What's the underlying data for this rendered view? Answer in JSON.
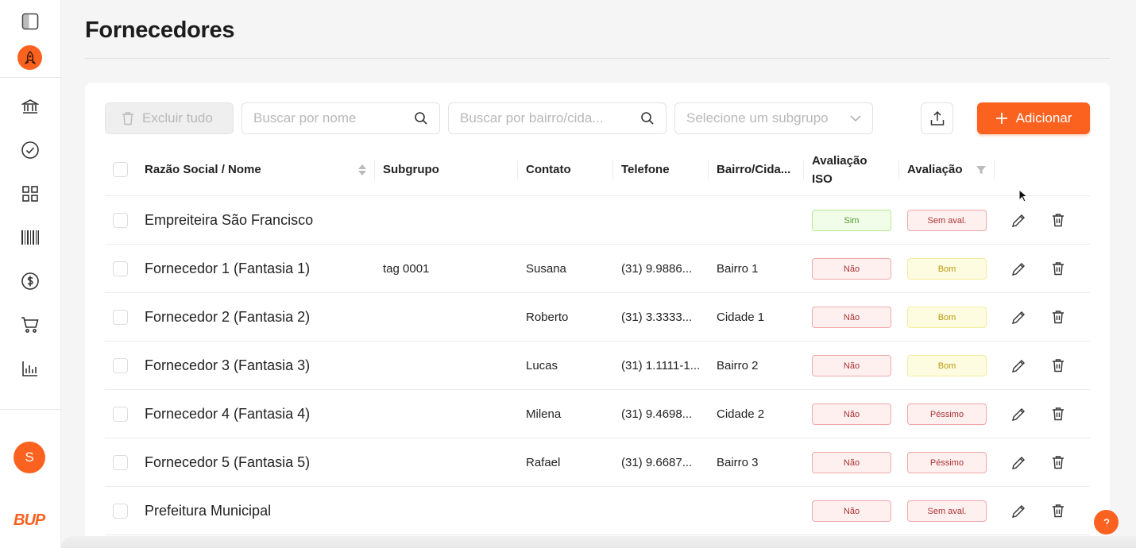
{
  "colors": {
    "accent": "#fb6220"
  },
  "sidebar": {
    "user_initial": "S",
    "brand": "BUP",
    "items": [
      {
        "icon": "bank-icon"
      },
      {
        "icon": "check-circle-icon"
      },
      {
        "icon": "grid-icon"
      },
      {
        "icon": "barcode-icon"
      },
      {
        "icon": "dollar-icon"
      },
      {
        "icon": "cart-icon"
      },
      {
        "icon": "bar-chart-icon"
      }
    ]
  },
  "header": {
    "title": "Fornecedores"
  },
  "toolbar": {
    "delete_all_label": "Excluir tudo",
    "search_name_placeholder": "Buscar por nome",
    "search_location_placeholder": "Buscar por bairro/cida...",
    "subgroup_placeholder": "Selecione um subgrupo",
    "add_label": "Adicionar"
  },
  "table": {
    "columns": {
      "name": "Razão Social / Nome",
      "subgroup": "Subgrupo",
      "contact": "Contato",
      "phone": "Telefone",
      "location": "Bairro/Cida...",
      "iso_line1": "Avaliação",
      "iso_line2": "ISO",
      "rating": "Avaliação"
    },
    "rows": [
      {
        "name": "Empreiteira São Francisco",
        "subgroup": "",
        "contact": "",
        "phone": "",
        "location": "",
        "iso": "Sim",
        "rating": "Sem aval."
      },
      {
        "name": "Fornecedor 1 (Fantasia 1)",
        "subgroup": "tag 0001",
        "contact": "Susana",
        "phone": "(31) 9.9886...",
        "location": "Bairro 1",
        "iso": "Não",
        "rating": "Bom"
      },
      {
        "name": "Fornecedor 2 (Fantasia 2)",
        "subgroup": "",
        "contact": "Roberto",
        "phone": "(31) 3.3333...",
        "location": "Cidade 1",
        "iso": "Não",
        "rating": "Bom"
      },
      {
        "name": "Fornecedor 3 (Fantasia 3)",
        "subgroup": "",
        "contact": "Lucas",
        "phone": "(31) 1.1111-1...",
        "location": "Bairro 2",
        "iso": "Não",
        "rating": "Bom"
      },
      {
        "name": "Fornecedor 4 (Fantasia 4)",
        "subgroup": "",
        "contact": "Milena",
        "phone": "(31) 9.4698...",
        "location": "Cidade 2",
        "iso": "Não",
        "rating": "Péssimo"
      },
      {
        "name": "Fornecedor 5 (Fantasia 5)",
        "subgroup": "",
        "contact": "Rafael",
        "phone": "(31) 9.6687...",
        "location": "Bairro 3",
        "iso": "Não",
        "rating": "Péssimo"
      },
      {
        "name": "Prefeitura Municipal",
        "subgroup": "",
        "contact": "",
        "phone": "",
        "location": "",
        "iso": "Não",
        "rating": "Sem aval."
      }
    ]
  }
}
